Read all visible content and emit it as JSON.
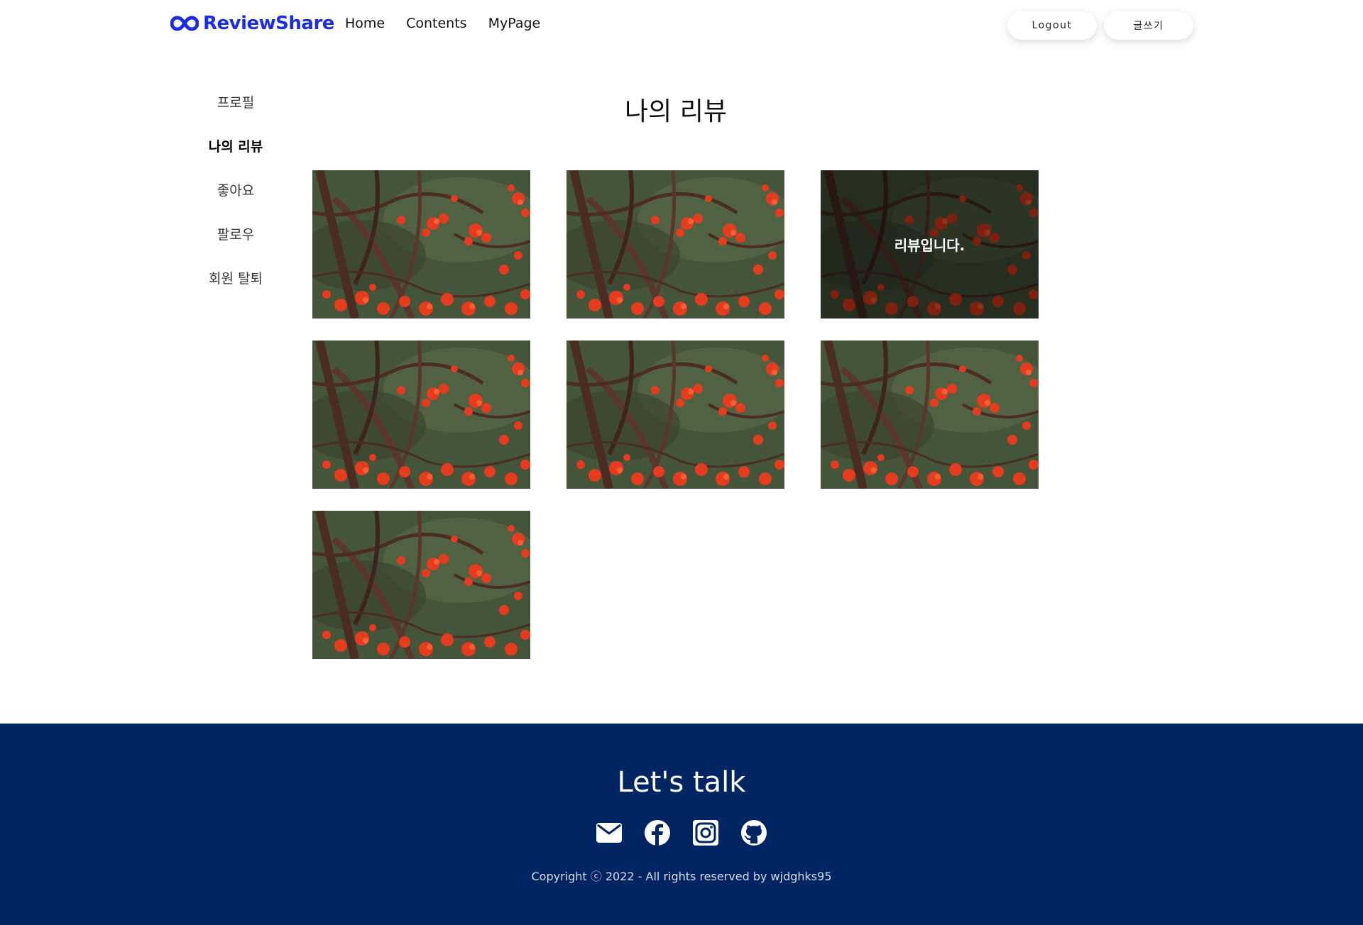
{
  "brand": {
    "name": "ReviewShare",
    "color": "#1b2de0",
    "logo_icon": "infinity-icon"
  },
  "nav": {
    "items": [
      {
        "label": "Home"
      },
      {
        "label": "Contents"
      },
      {
        "label": "MyPage"
      }
    ]
  },
  "header_actions": {
    "logout_label": "Logout",
    "write_label": "글쓰기"
  },
  "sidebar": {
    "items": [
      {
        "label": "프로필"
      },
      {
        "label": "나의 리뷰",
        "active": true
      },
      {
        "label": "좋아요"
      },
      {
        "label": "팔로우"
      },
      {
        "label": "회원 탈퇴"
      }
    ]
  },
  "main": {
    "title": "나의 리뷰",
    "cards": [
      {
        "image": "red-flowering-tree-photo"
      },
      {
        "image": "red-flowering-tree-photo"
      },
      {
        "image": "red-flowering-tree-photo",
        "overlay_text": "리뷰입니다."
      },
      {
        "image": "red-flowering-tree-photo"
      },
      {
        "image": "red-flowering-tree-photo"
      },
      {
        "image": "red-flowering-tree-photo"
      },
      {
        "image": "red-flowering-tree-photo"
      }
    ]
  },
  "footer": {
    "title": "Let's talk",
    "icons": [
      "envelope-icon",
      "facebook-icon",
      "instagram-icon",
      "github-icon"
    ],
    "copyright": "Copyright ⓒ 2022 - All rights reserved by wjdghks95",
    "background": "#012562"
  }
}
